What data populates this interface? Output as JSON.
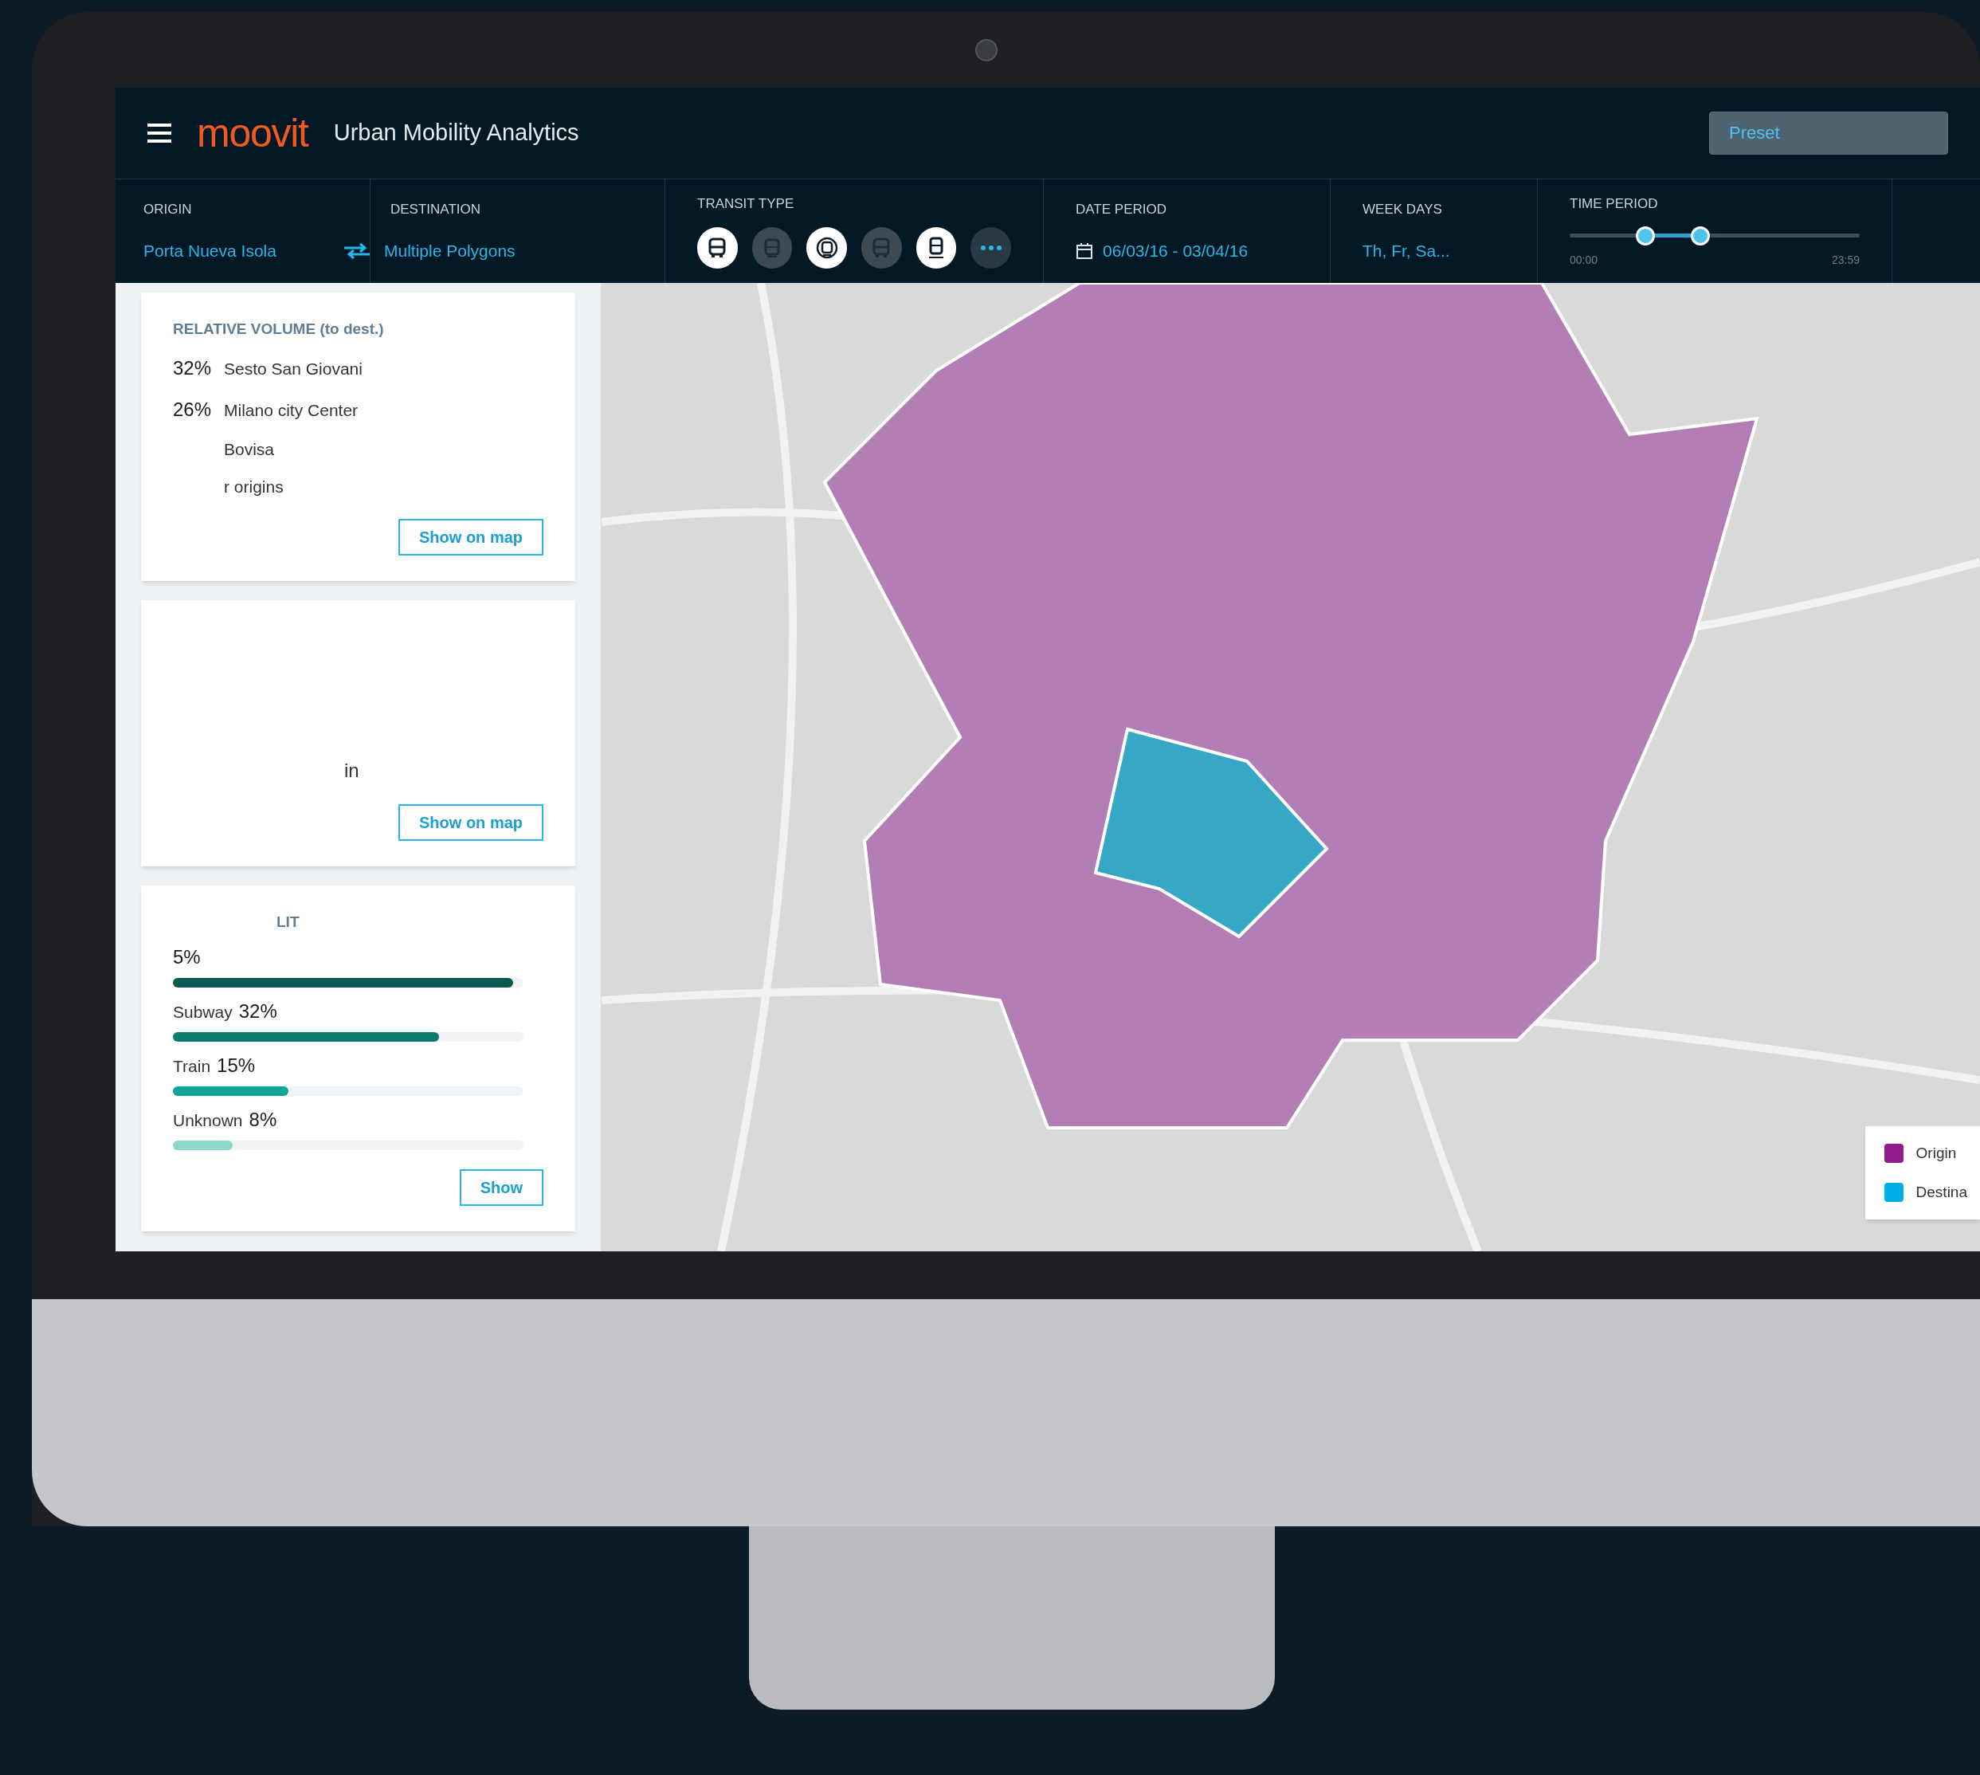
{
  "header": {
    "logo": "moovit",
    "title": "Urban Mobility Analytics",
    "preset": {
      "placeholder": "Preset"
    }
  },
  "filters": {
    "origin": {
      "label": "ORIGIN",
      "value": "Porta Nueva Isola"
    },
    "destination": {
      "label": "DESTINATION",
      "value": "Multiple Polygons"
    },
    "transit": {
      "label": "TRANSIT TYPE",
      "types": [
        {
          "kind": "bus",
          "selected": true
        },
        {
          "kind": "tram",
          "selected": false
        },
        {
          "kind": "subway",
          "selected": true
        },
        {
          "kind": "bus",
          "selected": false
        },
        {
          "kind": "train",
          "selected": true
        },
        {
          "kind": "more",
          "selected": false
        }
      ]
    },
    "date": {
      "label": "DATE PERIOD",
      "value": "06/03/16 - 03/04/16"
    },
    "weekdays": {
      "label": "WEEK DAYS",
      "value": "Th, Fr, Sa..."
    },
    "time": {
      "label": "TIME PERIOD",
      "thumbs": [
        {
          "level": 0.26
        },
        {
          "level": 0.45
        }
      ],
      "min": "00:00",
      "max": "23:59"
    }
  },
  "cards": [
    {
      "kind": "volume",
      "title": "RELATIVE VOLUME (to dest.)",
      "rows": [
        {
          "pct": "32%",
          "name": "Sesto San Giovani"
        },
        {
          "pct": "26%",
          "name": "Milano city Center"
        },
        {
          "name": "Bovisa"
        },
        {
          "name": "r origins"
        }
      ],
      "button": "Show on map"
    },
    {
      "kind": "text",
      "text": "in",
      "button": "Show on map"
    },
    {
      "kind": "split",
      "title": "LIT",
      "rows": [
        {
          "pct": "5%",
          "level": 0.97,
          "color": "#0b5a52"
        },
        {
          "name": "Subway",
          "pct": "32%",
          "level": 0.76,
          "color": "#0d7a6e"
        },
        {
          "name": "Train",
          "pct": "15%",
          "level": 0.33,
          "color": "#13a596"
        },
        {
          "name": "Unknown",
          "pct": "8%",
          "level": 0.17,
          "color": "#8fd6cd"
        }
      ],
      "button": "Show"
    }
  ],
  "legend": [
    {
      "label": "Origin",
      "color": "#8e1a8c"
    },
    {
      "label": "Destina",
      "color": "#00aee8"
    }
  ]
}
